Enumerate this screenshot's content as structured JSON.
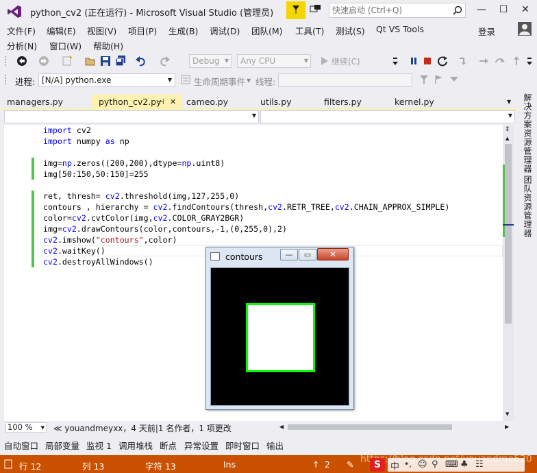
{
  "window": {
    "title": "python_cv2 (正在运行) - Microsoft Visual Studio (管理员)",
    "quick_launch_placeholder": "快速启动 (Ctrl+Q)",
    "min_glyph": "—",
    "max_glyph": "☐",
    "close_glyph": "✕"
  },
  "menu": {
    "row1": [
      "文件(F)",
      "编辑(E)",
      "视图(V)",
      "项目(P)",
      "生成(B)",
      "调试(D)",
      "团队(M)",
      "工具(T)",
      "测试(S)",
      "Qt VS Tools"
    ],
    "row2": [
      "分析(N)",
      "窗口(W)",
      "帮助(H)"
    ],
    "login": "登录"
  },
  "toolbar": {
    "config": "Debug",
    "platform": "Any CPU",
    "continue_label": "继续(C)"
  },
  "process_bar": {
    "process_label": "进程:",
    "process_value": "[N/A] python.exe",
    "lifecycle_label": "生命周期事件",
    "thread_label": "线程:"
  },
  "tabs": [
    {
      "label": "managers.py",
      "active": false
    },
    {
      "label": "python_cv2.py",
      "active": true,
      "pin": "⊣",
      "close": "✕"
    },
    {
      "label": "cameo.py",
      "active": false
    },
    {
      "label": "utils.py",
      "active": false
    },
    {
      "label": "filters.py",
      "active": false
    },
    {
      "label": "kernel.py",
      "active": false
    }
  ],
  "code": {
    "lines": [
      "import cv2",
      "import numpy as np",
      "",
      "img=np.zeros((200,200),dtype=np.uint8)",
      "img[50:150,50:150]=255",
      "",
      "ret, thresh= cv2.threshold(img,127,255,0)",
      "contours , hierarchy = cv2.findContours(thresh,cv2.RETR_TREE,cv2.CHAIN_APPROX_SIMPLE)",
      "color=cv2.cvtColor(img,cv2.COLOR_GRAY2BGR)",
      "img=cv2.drawContours(color,contours,-1,(0,255,0),2)",
      "cv2.imshow(\"contours\",color)",
      "cv2.waitKey()",
      "cv2.destroyAllWindows()"
    ]
  },
  "editor_footer": {
    "zoom": "100 %",
    "codelens": "youandmeyxx，4 天前|1 名作者，1 项更改"
  },
  "side_tabs": [
    "解决方案资源管理器",
    "团队资源管理器"
  ],
  "bottom_tabs": [
    "自动窗口",
    "局部变量",
    "监视 1",
    "调用堆栈",
    "断点",
    "异常设置",
    "即时窗口",
    "输出"
  ],
  "status": {
    "line": "行 12",
    "col": "列 13",
    "char": "字符 13",
    "mode": "Ins",
    "up_count": "2",
    "watermark": "https://blog.csdn.net/youandme520"
  },
  "cv_window": {
    "title": "contours",
    "min_glyph": "—",
    "max_glyph": "▭",
    "close_glyph": "✕"
  },
  "colors": {
    "accent": "#68217a",
    "status_bar": "#ca5100",
    "tab_active": "#fff2b0",
    "contour": "#00ff00",
    "change_bar": "#57c14f"
  }
}
